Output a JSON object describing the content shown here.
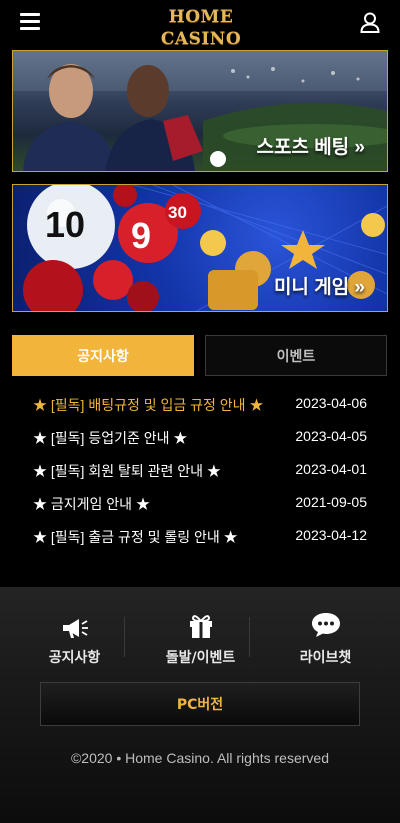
{
  "header": {
    "logo_text": "HOME CASINO"
  },
  "banners": [
    {
      "label": "스포츠 베팅 »"
    },
    {
      "label": "미니 게임 »"
    }
  ],
  "tabs": [
    {
      "label": "공지사항",
      "active": true
    },
    {
      "label": "이벤트",
      "active": false
    }
  ],
  "notices": [
    {
      "title": "★ [필독] 배팅규정 및 입금 규정 안내 ★",
      "date": "2023-04-06"
    },
    {
      "title": "★ [필독] 등업기준 안내 ★",
      "date": "2023-04-05"
    },
    {
      "title": "★ [필독] 회원 탈퇴 관련 안내 ★",
      "date": "2023-04-01"
    },
    {
      "title": "★ 금지게임 안내 ★",
      "date": "2021-09-05"
    },
    {
      "title": "★ [필독] 출금 규정 및 롤링 안내 ★",
      "date": "2023-04-12"
    }
  ],
  "footer": {
    "items": [
      {
        "label": "공지사항",
        "icon": "megaphone-icon"
      },
      {
        "label": "돌발/이벤트",
        "icon": "gift-icon"
      },
      {
        "label": "라이브챗",
        "icon": "chat-icon"
      }
    ],
    "pc_label": "PC버전",
    "copyright": "©2020 • Home Casino. All rights reserved"
  },
  "colors": {
    "accent": "#f2b53c",
    "border_gold": "#c9a23b",
    "background": "#000000"
  }
}
